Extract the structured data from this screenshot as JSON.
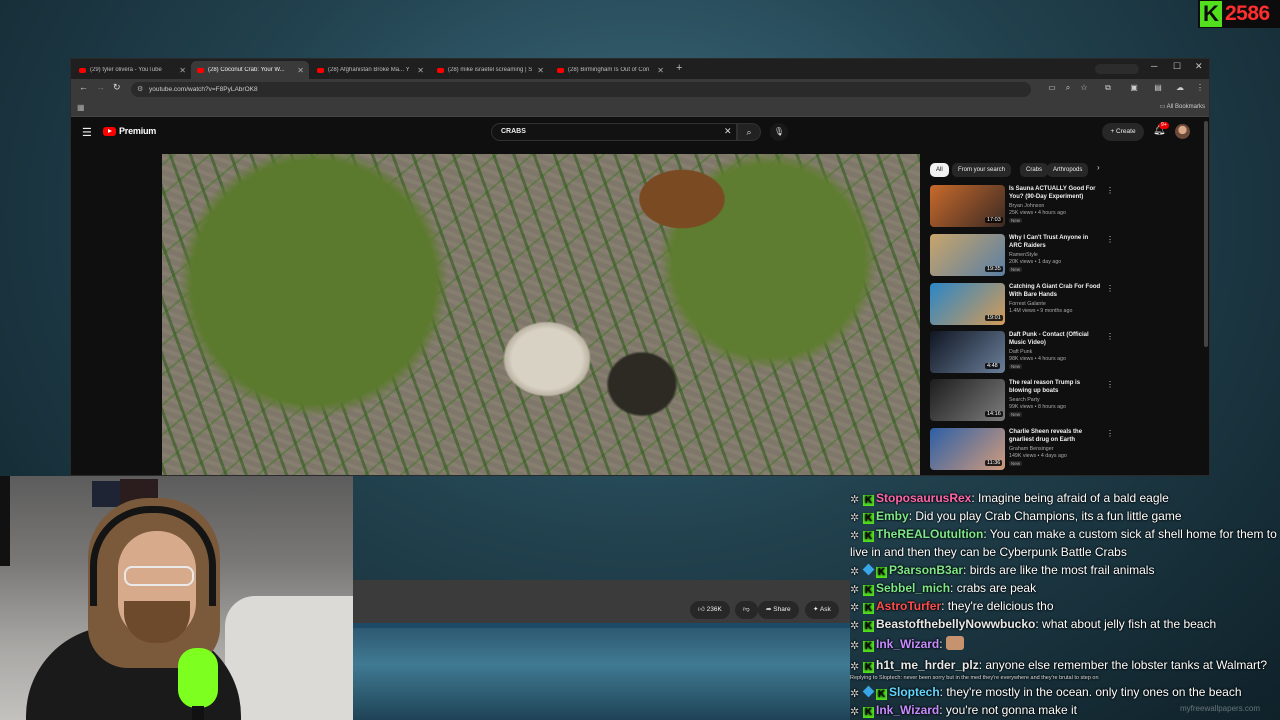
{
  "badge": {
    "k": "K",
    "count": "2586"
  },
  "browser": {
    "tabs": [
      {
        "title": "(29) tyler olivera - YouTube"
      },
      {
        "title": "(28) Coconut Crab: Your W..."
      },
      {
        "title": "(28) Afghanistan Broke Ma... Y"
      },
      {
        "title": "(28) mike israetel screaming | S"
      },
      {
        "title": "(28) Birmingham Is Out of Con"
      }
    ],
    "url": "youtube.com/watch?v=F8PyLAbrOK8",
    "all_bookmarks": "All Bookmarks"
  },
  "yt": {
    "brand": "Premium",
    "search_value": "CRABS",
    "create_label": "Create",
    "notification_count": "9+",
    "chips": [
      "All",
      "From your search",
      "Crabs",
      "Arthropods"
    ],
    "recommendations": [
      {
        "title": "Is Sauna ACTUALLY Good For You? (90-Day Experiment)",
        "channel": "Bryan Johnson",
        "meta": "25K views • 4 hours ago",
        "badge": "New",
        "duration": "17:03",
        "thumb_colors": [
          "#c86a2b",
          "#3b2a24"
        ]
      },
      {
        "title": "Why I Can't Trust Anyone in ARC Raiders",
        "channel": "RamenStyle",
        "meta": "20K views • 1 day ago",
        "badge": "New",
        "duration": "19:35",
        "thumb_colors": [
          "#c9a56a",
          "#5a7fa4"
        ]
      },
      {
        "title": "Catching A Giant Crab For Food With Bare Hands",
        "channel": "Forrest Galante",
        "meta": "1.4M views • 9 months ago",
        "badge": "",
        "duration": "19:01",
        "thumb_colors": [
          "#2b86c6",
          "#d49b57"
        ]
      },
      {
        "title": "Daft Punk - Contact (Official Music Video)",
        "channel": "Daft Punk",
        "meta": "98K views • 4 hours ago",
        "badge": "New",
        "duration": "4:48",
        "thumb_colors": [
          "#101622",
          "#6a7f9a"
        ]
      },
      {
        "title": "The real reason Trump is blowing up boats",
        "channel": "Search Party",
        "meta": "99K views • 8 hours ago",
        "badge": "New",
        "duration": "14:16",
        "thumb_colors": [
          "#1d1d1d",
          "#7c7c7c"
        ]
      },
      {
        "title": "Charlie Sheen reveals the gnarliest drug on Earth",
        "channel": "Graham Bensinger",
        "meta": "149K views • 4 days ago",
        "badge": "New",
        "duration": "11:36",
        "thumb_colors": [
          "#2d5fa6",
          "#d19b7c"
        ]
      }
    ],
    "actions": {
      "likes": "236K",
      "share": "Share",
      "ask": "Ask"
    }
  },
  "chat": {
    "messages": [
      {
        "user": "StoposaurusRex",
        "sep": ":",
        "text": " Imagine being afraid of a bald eagle",
        "color": "#ff66aa",
        "badges": [
          "star",
          "k"
        ]
      },
      {
        "user": "Emby",
        "sep": ":",
        "text": " Did you play Crab Champions, its a fun little game",
        "color": "#7ee787",
        "badges": [
          "star",
          "k"
        ]
      },
      {
        "user": "TheREALOutultion",
        "sep": ":",
        "text": " You can make a custom sick af shell home for them to live in and then they can be Cyberpunk Battle Crabs",
        "color": "#7ee787",
        "badges": [
          "star",
          "k"
        ]
      },
      {
        "user": "P3arsonB3ar",
        "sep": ":",
        "text": " birds are like the most frail animals",
        "color": "#7ee787",
        "badges": [
          "star",
          "dia",
          "k"
        ]
      },
      {
        "user": "Sebbel_mich",
        "sep": ":",
        "text": " crabs are peak",
        "color": "#7ee787",
        "badges": [
          "star",
          "k"
        ]
      },
      {
        "user": "AstroTurfer",
        "sep": ":",
        "text": " they're delicious tho",
        "color": "#ff4d4d",
        "badges": [
          "star",
          "k"
        ]
      },
      {
        "user": "BeastofthebellyNowwbucko",
        "sep": ":",
        "text": " what about jelly fish at the beach",
        "color": "#e8e8e8",
        "badges": [
          "star",
          "k"
        ]
      },
      {
        "user": "Ink_Wizard",
        "sep": ":",
        "text": "",
        "color": "#c78bff",
        "badges": [
          "star",
          "k"
        ]
      },
      {
        "user": "h1t_me_hrder_plz",
        "sep": ":",
        "text": " anyone else remember the lobster tanks at Walmart?",
        "color": "#e8e8e8",
        "badges": [
          "star",
          "k"
        ]
      },
      {
        "user": "",
        "sep": "",
        "text": "Replying to Sloptech: never been sorry but in the med they're everywhere and they're brutal to step on",
        "color": "#ddd",
        "badges": []
      },
      {
        "user": "Sloptech",
        "sep": ":",
        "text": " they're mostly in the ocean. only tiny ones on the beach",
        "color": "#62d6ff",
        "badges": [
          "star",
          "dia",
          "k"
        ]
      },
      {
        "user": "Ink_Wizard",
        "sep": ":",
        "text": " you're not gonna make it",
        "color": "#c78bff",
        "badges": [
          "star",
          "k"
        ]
      }
    ]
  },
  "watermark": "myfreewallpapers.com"
}
